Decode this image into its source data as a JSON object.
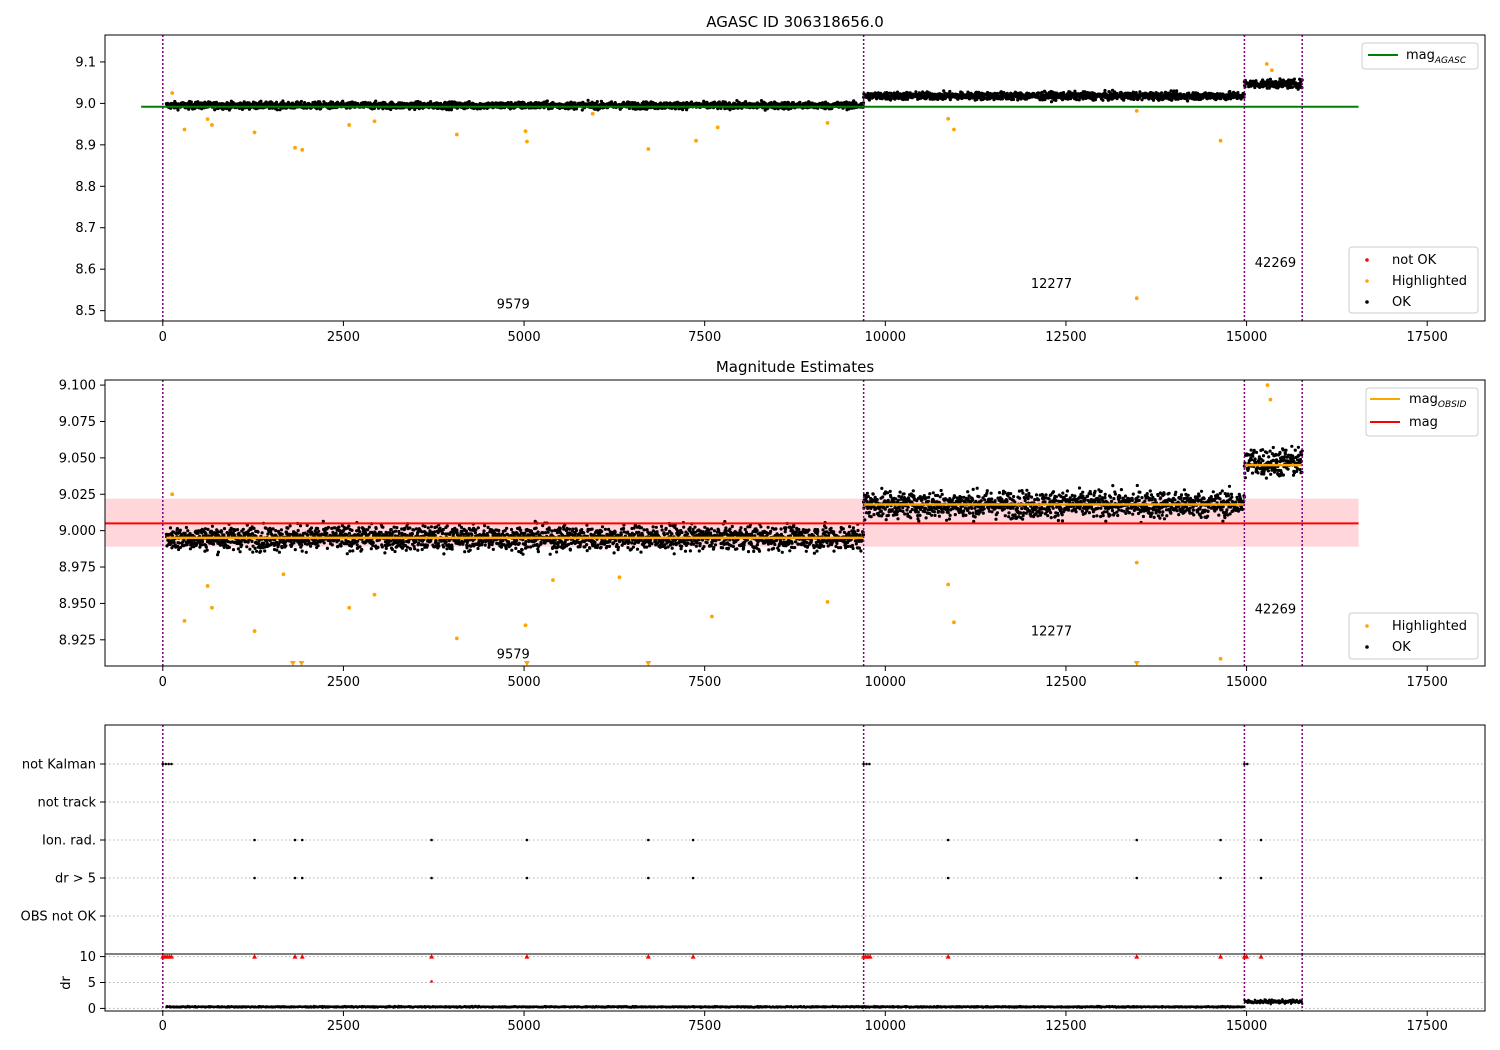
{
  "colors": {
    "ok": "#000000",
    "highlighted": "#ffa500",
    "not_ok": "#ff0000",
    "agasc_line": "#008000",
    "obsid_line": "#ffa500",
    "mag_line": "#ff0000",
    "band": "#ffd6da",
    "obs_boundary": "#800080",
    "grid": "#b0b0b0"
  },
  "chart_data": [
    {
      "type": "scatter",
      "title": "AGASC ID 306318656.0",
      "xlim": [
        -800,
        18300
      ],
      "ylim": [
        8.475,
        9.165
      ],
      "xticks": [
        0,
        2500,
        5000,
        7500,
        10000,
        12500,
        15000,
        17500
      ],
      "yticks": [
        8.5,
        8.6,
        8.7,
        8.8,
        8.9,
        9.0,
        9.1
      ],
      "obs_boundaries": [
        0,
        9700,
        14970,
        15770
      ],
      "obs_labels": [
        {
          "text": "9579",
          "x": 4850,
          "y": 8.505
        },
        {
          "text": "12277",
          "x": 12300,
          "y": 8.555
        },
        {
          "text": "42269",
          "x": 15400,
          "y": 8.605
        }
      ],
      "segments": [
        {
          "x0": 50,
          "x1": 9700,
          "center": 8.995,
          "spread": 0.01
        },
        {
          "x0": 9700,
          "x1": 14970,
          "center": 9.018,
          "spread": 0.011
        },
        {
          "x0": 14970,
          "x1": 15770,
          "center": 9.047,
          "spread": 0.012
        }
      ],
      "highlighted": [
        [
          130,
          9.025
        ],
        [
          300,
          8.937
        ],
        [
          620,
          8.962
        ],
        [
          680,
          8.948
        ],
        [
          1270,
          8.93
        ],
        [
          1830,
          8.893
        ],
        [
          1930,
          8.888
        ],
        [
          2580,
          8.948
        ],
        [
          2930,
          8.957
        ],
        [
          4070,
          8.925
        ],
        [
          5020,
          8.933
        ],
        [
          5040,
          8.908
        ],
        [
          5950,
          8.975
        ],
        [
          6720,
          8.89
        ],
        [
          7380,
          8.91
        ],
        [
          7680,
          8.942
        ],
        [
          9200,
          8.953
        ],
        [
          10870,
          8.963
        ],
        [
          10950,
          8.937
        ],
        [
          13480,
          8.982
        ],
        [
          13480,
          8.53
        ],
        [
          14640,
          8.91
        ],
        [
          15280,
          9.095
        ],
        [
          15350,
          9.08
        ]
      ],
      "agasc_mag": 8.992,
      "legend_lines": [
        {
          "label": "mag",
          "sub": "AGASC"
        }
      ],
      "legend_points": [
        "not OK",
        "Highlighted",
        "OK"
      ]
    },
    {
      "type": "scatter",
      "title": "Magnitude Estimates",
      "xlim": [
        -800,
        18300
      ],
      "ylim": [
        8.907,
        9.1035
      ],
      "xticks": [
        0,
        2500,
        5000,
        7500,
        10000,
        12500,
        15000,
        17500
      ],
      "yticks": [
        8.925,
        8.95,
        8.975,
        9.0,
        9.025,
        9.05,
        9.075,
        9.1
      ],
      "obs_boundaries": [
        0,
        9700,
        14970,
        15770
      ],
      "obs_labels": [
        {
          "text": "9579",
          "x": 4850,
          "y": 8.912
        },
        {
          "text": "12277",
          "x": 12300,
          "y": 8.928
        },
        {
          "text": "42269",
          "x": 15400,
          "y": 8.943
        }
      ],
      "mag": 9.005,
      "mag_band": [
        8.989,
        9.022
      ],
      "obsid_mag": [
        {
          "x0": 50,
          "x1": 9700,
          "mag": 8.995
        },
        {
          "x0": 9700,
          "x1": 14970,
          "mag": 9.018
        },
        {
          "x0": 14970,
          "x1": 15770,
          "mag": 9.045
        }
      ],
      "segments": [
        {
          "x0": 50,
          "x1": 9700,
          "center": 8.995,
          "spread": 0.01
        },
        {
          "x0": 9700,
          "x1": 14970,
          "center": 9.018,
          "spread": 0.011
        },
        {
          "x0": 14970,
          "x1": 15770,
          "center": 9.047,
          "spread": 0.012
        }
      ],
      "highlighted": [
        [
          130,
          9.025
        ],
        [
          300,
          8.938
        ],
        [
          620,
          8.962
        ],
        [
          680,
          8.947
        ],
        [
          1270,
          8.931
        ],
        [
          1670,
          8.97
        ],
        [
          2580,
          8.947
        ],
        [
          2930,
          8.956
        ],
        [
          4070,
          8.926
        ],
        [
          5020,
          8.935
        ],
        [
          5400,
          8.966
        ],
        [
          6320,
          8.968
        ],
        [
          7600,
          8.941
        ],
        [
          9200,
          8.951
        ],
        [
          10870,
          8.963
        ],
        [
          10950,
          8.937
        ],
        [
          13480,
          8.978
        ],
        [
          14640,
          8.912
        ],
        [
          15290,
          9.1
        ],
        [
          15330,
          9.09
        ]
      ],
      "off_scale": [
        1800,
        1920,
        5040,
        6720,
        13480
      ],
      "legend_lines": [
        {
          "label": "mag",
          "sub": "OBSID"
        },
        {
          "label": "mag",
          "sub": ""
        }
      ],
      "legend_points": [
        "Highlighted",
        "OK"
      ]
    },
    {
      "type": "scatter",
      "xlim": [
        -800,
        18300
      ],
      "xticks": [
        0,
        2500,
        5000,
        7500,
        10000,
        12500,
        15000,
        17500
      ],
      "flag_rows": [
        "not Kalman",
        "not track",
        "Ion. rad.",
        "dr > 5",
        "OBS not OK"
      ],
      "obs_boundaries": [
        0,
        9700,
        14970,
        15770
      ],
      "flag_points": {
        "not Kalman": [
          0,
          40,
          80,
          120,
          9700,
          9740,
          9780,
          14970,
          15010
        ],
        "not track": [],
        "Ion. rad.": [
          1270,
          1830,
          1930,
          3720,
          5040,
          6720,
          7340,
          10870,
          13480,
          14640,
          15200
        ],
        "dr > 5": [
          1270,
          1830,
          1930,
          3720,
          5040,
          6720,
          7340,
          10870,
          13480,
          14640,
          15200
        ],
        "OBS not OK": []
      }
    },
    {
      "type": "scatter",
      "ylabel": "dr",
      "xlim": [
        -800,
        18300
      ],
      "ylim": [
        -0.5,
        10.5
      ],
      "yticks": [
        0,
        5,
        10
      ],
      "xticks": [
        0,
        2500,
        5000,
        7500,
        10000,
        12500,
        15000,
        17500
      ],
      "xticklabels": [
        "0",
        "2500",
        "5000",
        "7500",
        "10000",
        "12500",
        "15000",
        "17500"
      ],
      "obs_boundaries": [
        0,
        9700,
        14970,
        15770
      ],
      "capped_points": [
        0,
        30,
        60,
        90,
        120,
        1270,
        1830,
        1930,
        3720,
        5040,
        6720,
        7340,
        9700,
        9730,
        9760,
        9790,
        10870,
        13480,
        14640,
        14970,
        15000,
        15200
      ],
      "mid_points": [
        [
          3720,
          5.2
        ]
      ],
      "segments": [
        {
          "x0": 50,
          "x1": 14970,
          "center": 0.3,
          "spread": 0.15
        },
        {
          "x0": 14970,
          "x1": 15770,
          "center": 1.3,
          "spread": 0.45
        }
      ]
    }
  ]
}
